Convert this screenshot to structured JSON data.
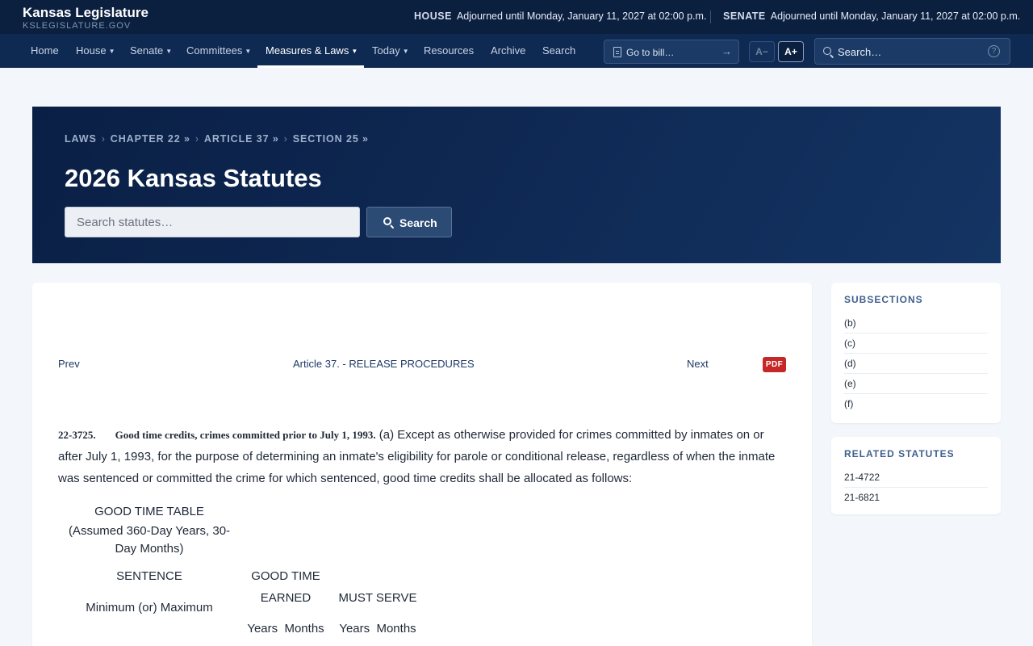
{
  "header": {
    "brand_name": "Kansas Legislature",
    "brand_site": "KSLEGISLATURE.GOV",
    "house_label": "HOUSE",
    "house_status": "Adjourned until Monday, January 11, 2027 at 02:00 p.m.",
    "senate_label": "SENATE",
    "senate_status": "Adjourned until Monday, January 11, 2027 at 02:00 p.m."
  },
  "nav": {
    "items": [
      {
        "label": "Home"
      },
      {
        "label": "House"
      },
      {
        "label": "Senate"
      },
      {
        "label": "Committees"
      },
      {
        "label": "Measures & Laws"
      },
      {
        "label": "Today"
      },
      {
        "label": "Resources"
      },
      {
        "label": "Archive"
      },
      {
        "label": "Search"
      }
    ],
    "active": "Measures & Laws",
    "goto_placeholder": "Go to bill…",
    "font_decrease": "A−",
    "font_increase": "A+",
    "search_placeholder": "Search…",
    "help_glyph": "?"
  },
  "hero": {
    "breadcrumb": [
      "LAWS",
      "CHAPTER 22 »",
      "ARTICLE 37 »",
      "SECTION 25 »"
    ],
    "title": "2026 Kansas Statutes",
    "search_placeholder": "Search statutes…",
    "search_button": "Search"
  },
  "document": {
    "prev": "Prev",
    "article": "Article 37. - RELEASE PROCEDURES",
    "next": "Next",
    "pdf": "PDF",
    "section_number": "22-3725.",
    "section_heading": "Good time credits, crimes committed prior to July 1, 1993.",
    "section_text": "(a) Except as otherwise provided for crimes committed by inmates on or after July 1, 1993, for the purpose of determining an inmate's eligibility for parole or conditional release, regardless of when the inmate was sentenced or committed the crime for which sentenced, good time credits shall be allocated as follows:",
    "table": {
      "title": "GOOD TIME TABLE",
      "subtitle": "(Assumed 360-Day Years, 30-Day Months)",
      "col_sentence": "SENTENCE",
      "col_good_time": "GOOD TIME",
      "col_earned": "EARNED",
      "col_must_serve": "MUST SERVE",
      "row_min_max": "Minimum (or) Maximum",
      "years_months_1": "Years  Months",
      "years_months_2": "Years  Months"
    }
  },
  "sidebar": {
    "subsections_heading": "SUBSECTIONS",
    "subsections": [
      "(b)",
      "(c)",
      "(d)",
      "(e)",
      "(f)"
    ],
    "related_heading": "RELATED STATUTES",
    "related": [
      "21-4722",
      "21-6821"
    ]
  }
}
